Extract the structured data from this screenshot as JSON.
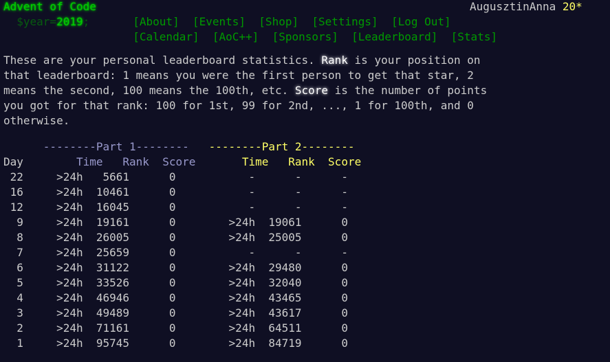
{
  "header": {
    "title": "Advent of Code",
    "year_prefix": "  $year=",
    "year": "2019",
    "year_suffix": ";",
    "nav_row1": [
      "[About]",
      "[Events]",
      "[Shop]",
      "[Settings]",
      "[Log Out]"
    ],
    "nav_row2": [
      "[Calendar]",
      "[AoC++]",
      "[Sponsors]",
      "[Leaderboard]",
      "[Stats]"
    ],
    "user": "AugusztinAnna",
    "stars": "20*"
  },
  "intro": {
    "line1_a": "These are your personal leaderboard statistics. ",
    "rank_word": "Rank",
    "line1_b": " is your position on",
    "line2": "that leaderboard: 1 means you were the first person to get that star, 2",
    "line3_a": "means the second, 100 means the 100th, etc. ",
    "score_word": "Score",
    "line3_b": " is the number of points",
    "line4": "you got for that rank: 100 for 1st, 99 for 2nd, ..., 1 for 100th, and 0",
    "line5": "otherwise."
  },
  "table": {
    "part1_header": "--------Part 1--------",
    "part2_header": "--------Part 2--------",
    "day_header": "Day",
    "columns": [
      "Time",
      "Rank",
      "Score"
    ],
    "rows": [
      {
        "day": "22",
        "p1": [
          ">24h",
          "5661",
          "0"
        ],
        "p2": [
          "-",
          "-",
          "-"
        ]
      },
      {
        "day": "16",
        "p1": [
          ">24h",
          "10461",
          "0"
        ],
        "p2": [
          "-",
          "-",
          "-"
        ]
      },
      {
        "day": "12",
        "p1": [
          ">24h",
          "16045",
          "0"
        ],
        "p2": [
          "-",
          "-",
          "-"
        ]
      },
      {
        "day": "9",
        "p1": [
          ">24h",
          "19161",
          "0"
        ],
        "p2": [
          ">24h",
          "19061",
          "0"
        ]
      },
      {
        "day": "8",
        "p1": [
          ">24h",
          "26005",
          "0"
        ],
        "p2": [
          ">24h",
          "25005",
          "0"
        ]
      },
      {
        "day": "7",
        "p1": [
          ">24h",
          "25659",
          "0"
        ],
        "p2": [
          "-",
          "-",
          "-"
        ]
      },
      {
        "day": "6",
        "p1": [
          ">24h",
          "31122",
          "0"
        ],
        "p2": [
          ">24h",
          "29480",
          "0"
        ]
      },
      {
        "day": "5",
        "p1": [
          ">24h",
          "33526",
          "0"
        ],
        "p2": [
          ">24h",
          "32040",
          "0"
        ]
      },
      {
        "day": "4",
        "p1": [
          ">24h",
          "46946",
          "0"
        ],
        "p2": [
          ">24h",
          "43465",
          "0"
        ]
      },
      {
        "day": "3",
        "p1": [
          ">24h",
          "49489",
          "0"
        ],
        "p2": [
          ">24h",
          "43617",
          "0"
        ]
      },
      {
        "day": "2",
        "p1": [
          ">24h",
          "71161",
          "0"
        ],
        "p2": [
          ">24h",
          "64511",
          "0"
        ]
      },
      {
        "day": "1",
        "p1": [
          ">24h",
          "95745",
          "0"
        ],
        "p2": [
          ">24h",
          "84719",
          "0"
        ]
      }
    ]
  }
}
